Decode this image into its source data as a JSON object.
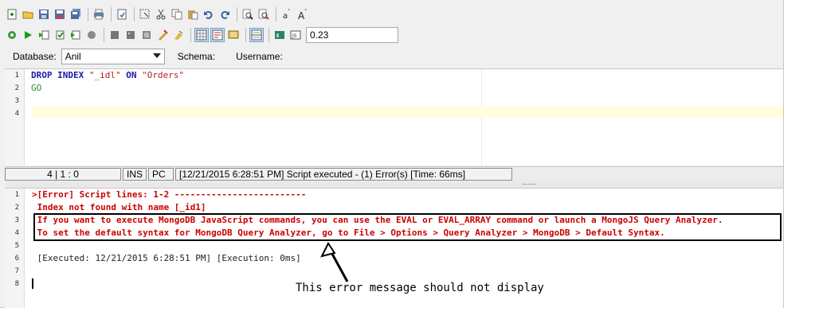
{
  "toolbar": {
    "row1_icons": [
      "new-query-icon",
      "open-icon",
      "save-icon",
      "save-as-icon",
      "save-all-icon",
      "print-icon",
      "export-icon",
      "select-all-icon",
      "cut-icon",
      "copy-icon",
      "paste-icon",
      "undo-icon",
      "redo-icon",
      "find-icon",
      "replace-icon",
      "font-smaller-icon",
      "font-larger-icon"
    ],
    "row2_icons": [
      "execute-all-icon",
      "execute-icon",
      "execute-step-icon",
      "execute-selection-icon",
      "execute-current-icon",
      "stop-icon",
      "comment-icon",
      "uncomment-icon",
      "indent-icon",
      "format-icon",
      "clear-icon",
      "grid-view-icon",
      "text-view-icon",
      "results-icon",
      "split-view-icon",
      "chart-icon",
      "query-plan-icon"
    ],
    "zoom_value": "0.23"
  },
  "connection": {
    "database_label": "Database:",
    "database_value": "Anil",
    "schema_label": "Schema:",
    "username_label": "Username:"
  },
  "editor": {
    "line_numbers": [
      "1",
      "2",
      "3",
      "4"
    ],
    "line1": {
      "kw1": "DROP",
      "kw2": "INDEX",
      "str1": "\"_idl\"",
      "kw3": "ON",
      "str2": "\"Orders\""
    },
    "line2": "GO"
  },
  "status": {
    "position": "4 | 1 : 0",
    "mode": "INS",
    "type": "PC",
    "message": "[12/21/2015 6:28:51 PM] Script executed - (1) Error(s) [Time: 66ms]"
  },
  "output": {
    "line_numbers": [
      "1",
      "2",
      "3",
      "4",
      "5",
      "6",
      "7",
      "8"
    ],
    "lines": [
      ">[Error] Script lines: 1-2 -------------------------",
      " Index not found with name [_id1]",
      " If you want to execute MongoDB JavaScript commands, you can use the EVAL or EVAL_ARRAY command or launch a MongoJS Query Analyzer.",
      " To set the default syntax for MongoDB Query Analyzer, go to File > Options > Query Analyzer > MongoDB > Default Syntax.",
      "",
      " [Executed: 12/21/2015 6:28:51 PM] [Execution: 0ms]",
      "",
      ""
    ]
  },
  "annotation": {
    "text": "This error message should not display"
  }
}
